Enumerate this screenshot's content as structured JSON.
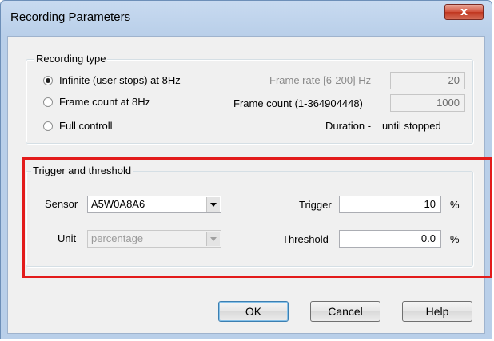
{
  "window": {
    "title": "Recording Parameters",
    "close_glyph": "x"
  },
  "recording_type": {
    "legend": "Recording type",
    "options": [
      {
        "label": "Infinite (user stops) at 8Hz",
        "checked": true
      },
      {
        "label": "Frame count at 8Hz",
        "checked": false
      },
      {
        "label": "Full controll",
        "checked": false
      }
    ],
    "frame_rate_label": "Frame rate [6-200] Hz",
    "frame_rate_value": "20",
    "frame_count_label": "Frame count (1-364904448)",
    "frame_count_value": "1000",
    "duration_label": "Duration -",
    "duration_value": "until stopped"
  },
  "trigger": {
    "legend": "Trigger and threshold",
    "sensor_label": "Sensor",
    "sensor_value": "A5W0A8A6",
    "unit_label": "Unit",
    "unit_value": "percentage",
    "trigger_label": "Trigger",
    "trigger_value": "10",
    "trigger_unit": "%",
    "threshold_label": "Threshold",
    "threshold_value": "0.0",
    "threshold_unit": "%"
  },
  "buttons": {
    "ok": "OK",
    "cancel": "Cancel",
    "help": "Help"
  },
  "colors": {
    "highlight": "#e31b1b",
    "close": "#c0361f"
  }
}
